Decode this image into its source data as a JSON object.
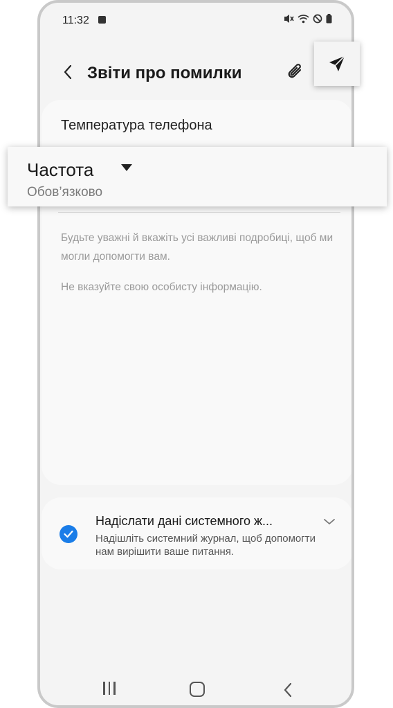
{
  "status_bar": {
    "time": "11:32",
    "icons": [
      "notification-check-icon",
      "mute-icon",
      "wifi-icon",
      "dnd-icon",
      "battery-icon"
    ]
  },
  "app_bar": {
    "title": "Звіти про помилки",
    "back_icon": "chevron-left-icon",
    "attach_icon": "paperclip-icon",
    "send_icon": "send-icon"
  },
  "form": {
    "phone_temperature_label": "Температура телефона",
    "frequency": {
      "label": "Частота",
      "required_text": "Обов’язково"
    },
    "description_hint": "Будьте уважні й вкажіть усі важливі подробиці, щоб ми могли допомогти вам.",
    "privacy_hint": "Не вказуйте свою особисту інформацію."
  },
  "system_log": {
    "title": "Надіслати дані системного ж...",
    "description": "Надішліть системний журнал, щоб допомогти нам вирішити ваше питання.",
    "checked": true
  },
  "nav_bar": {
    "items": [
      "recents-icon",
      "home-icon",
      "back-icon"
    ]
  },
  "colors": {
    "accent": "#1a7de8",
    "background": "#f4f4f4",
    "card": "#f9f9f9",
    "text_primary": "#1a1a1a",
    "text_hint": "#9a9a9a"
  }
}
